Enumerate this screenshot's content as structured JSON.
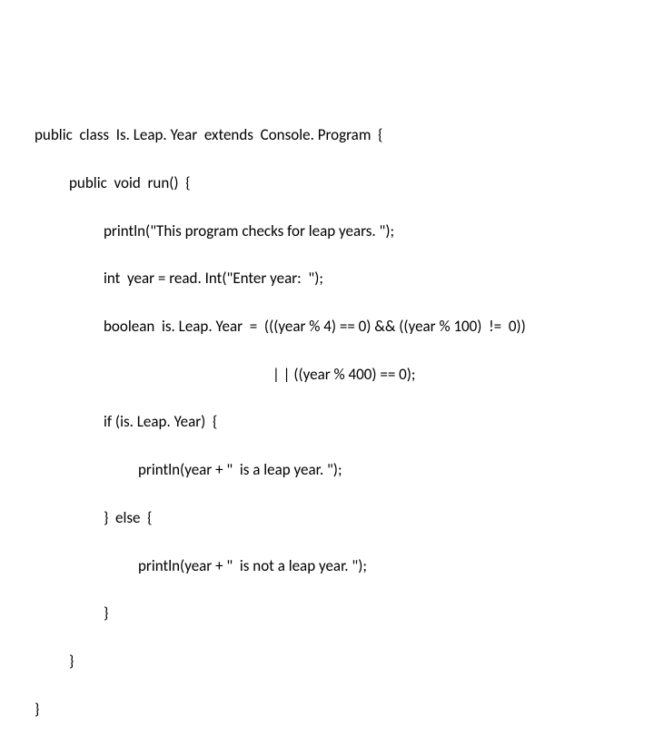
{
  "code": {
    "l1": "public  class  Is. Leap. Year  extends  Console. Program  {",
    "l2": "public  void  run()  {",
    "l3": "println(\"This program checks for leap years. \");",
    "l4": "int  year = read. Int(\"Enter year:  \");",
    "l5": "boolean  is. Leap. Year  =  (((year % 4) == 0) && ((year % 100)  !=  0))",
    "l6": "| | ((year % 400) == 0);",
    "l7": "if (is. Leap. Year)  {",
    "l8": "println(year + \"  is a leap year. \");",
    "l9": "}  else  {",
    "l10": "println(year + \"  is not a leap year. \");",
    "l11": "}",
    "l12": "}",
    "l13": "}"
  }
}
